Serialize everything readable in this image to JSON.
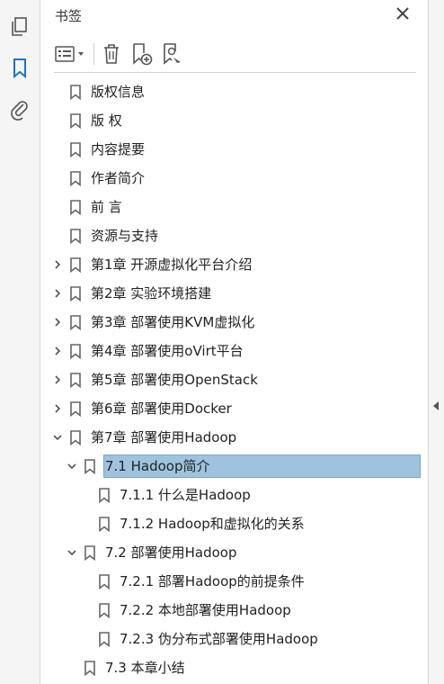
{
  "panel": {
    "title": "书签"
  },
  "tree": [
    {
      "label": "版权信息",
      "depth": 0,
      "expander": "none"
    },
    {
      "label": "版 权",
      "depth": 0,
      "expander": "none"
    },
    {
      "label": "内容提要",
      "depth": 0,
      "expander": "none"
    },
    {
      "label": "作者简介",
      "depth": 0,
      "expander": "none"
    },
    {
      "label": "前 言",
      "depth": 0,
      "expander": "none"
    },
    {
      "label": "资源与支持",
      "depth": 0,
      "expander": "none"
    },
    {
      "label": "第1章 开源虚拟化平台介绍",
      "depth": 0,
      "expander": "collapsed"
    },
    {
      "label": "第2章 实验环境搭建",
      "depth": 0,
      "expander": "collapsed"
    },
    {
      "label": "第3章 部署使用KVM虚拟化",
      "depth": 0,
      "expander": "collapsed"
    },
    {
      "label": "第4章 部署使用oVirt平台",
      "depth": 0,
      "expander": "collapsed"
    },
    {
      "label": "第5章 部署使用OpenStack",
      "depth": 0,
      "expander": "collapsed"
    },
    {
      "label": "第6章 部署使用Docker",
      "depth": 0,
      "expander": "collapsed"
    },
    {
      "label": "第7章 部署使用Hadoop",
      "depth": 0,
      "expander": "expanded"
    },
    {
      "label": "7.1 Hadoop简介",
      "depth": 1,
      "expander": "expanded",
      "selected": true
    },
    {
      "label": "7.1.1 什么是Hadoop",
      "depth": 2,
      "expander": "none"
    },
    {
      "label": "7.1.2 Hadoop和虚拟化的关系",
      "depth": 2,
      "expander": "none"
    },
    {
      "label": "7.2 部署使用Hadoop",
      "depth": 1,
      "expander": "expanded"
    },
    {
      "label": "7.2.1 部署Hadoop的前提条件",
      "depth": 2,
      "expander": "none"
    },
    {
      "label": "7.2.2 本地部署使用Hadoop",
      "depth": 2,
      "expander": "none"
    },
    {
      "label": "7.2.3 伪分布式部署使用Hadoop",
      "depth": 2,
      "expander": "none"
    },
    {
      "label": "7.3 本章小结",
      "depth": 1,
      "expander": "none"
    }
  ],
  "colors": {
    "selection": "#9ec3de",
    "accent": "#1a73c8",
    "icon": "#555555"
  }
}
